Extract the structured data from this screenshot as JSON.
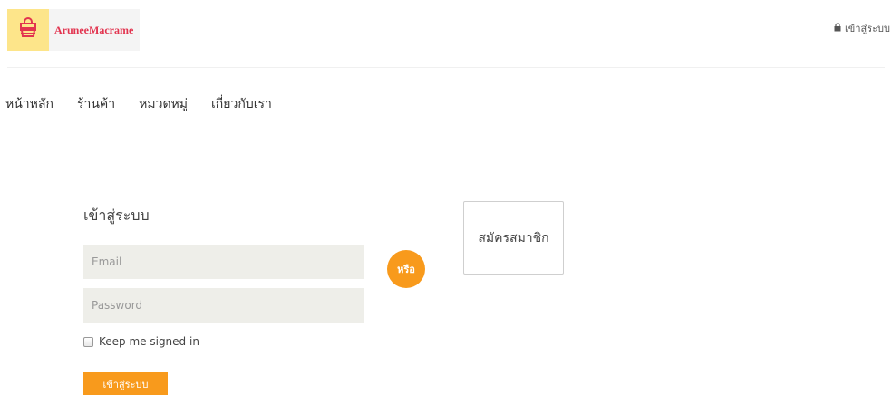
{
  "brand": {
    "name": "AruneeMacrame",
    "logo_icon": "shopping-bag-icon"
  },
  "header": {
    "login_link": "เข้าสู่ระบบ",
    "login_icon": "lock-icon"
  },
  "nav": {
    "items": [
      {
        "label": "หน้าหลัก"
      },
      {
        "label": "ร้านค้า"
      },
      {
        "label": "หมวดหมู่"
      },
      {
        "label": "เกี่ยวกับเรา"
      }
    ]
  },
  "login_form": {
    "title": "เข้าสู่ระบบ",
    "email_placeholder": "Email",
    "email_value": "",
    "password_placeholder": "Password",
    "password_value": "",
    "remember_label": "Keep me signed in",
    "remember_checked": false,
    "submit_label": "เข้าสู่ระบบ"
  },
  "or_label": "หรือ",
  "register": {
    "label": "สมัครสมาชิก"
  },
  "colors": {
    "accent": "#f89a1c",
    "brand_text": "#e2344f",
    "logo_bg": "#fde58a",
    "input_bg": "#eeeee9"
  }
}
